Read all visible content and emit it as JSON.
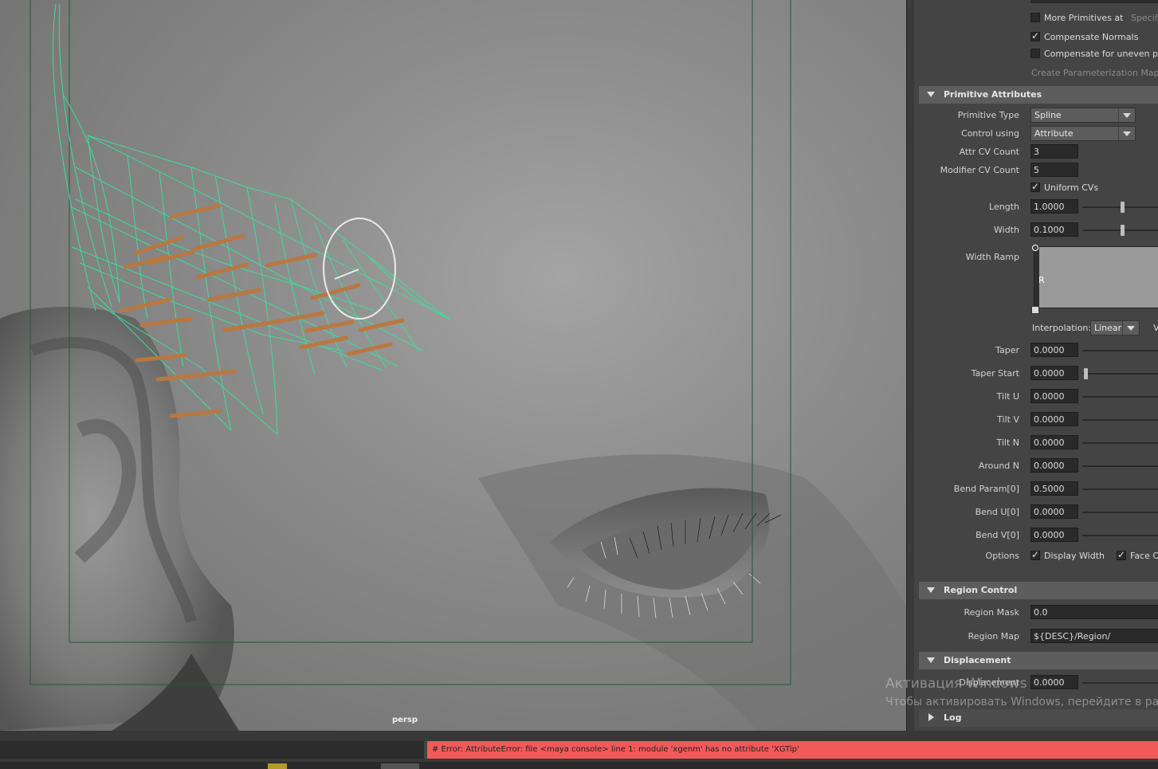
{
  "viewport": {
    "camera": "persp"
  },
  "panel": {
    "more_primitives": {
      "label": "More Primitives at",
      "trail": "Specify",
      "checked": false
    },
    "compensate_normals": {
      "label": "Compensate Normals",
      "checked": true
    },
    "compensate_uneven": {
      "label": "Compensate for uneven par",
      "checked": false
    },
    "create_param_map": "Create Parameterization Map",
    "sections": {
      "primitive_attributes": "Primitive Attributes",
      "region_control": "Region Control",
      "displacement": "Displacement",
      "log": "Log"
    },
    "primitive_type": {
      "label": "Primitive Type",
      "value": "Spline"
    },
    "control_using": {
      "label": "Control using",
      "value": "Attribute"
    },
    "attr_cv_count": {
      "label": "Attr CV Count",
      "value": "3"
    },
    "modifier_cv_count": {
      "label": "Modifier CV Count",
      "value": "5"
    },
    "uniform_cvs": {
      "label": "Uniform CVs",
      "checked": true
    },
    "length": {
      "label": "Length",
      "value": "1.0000",
      "slider": 0.45
    },
    "width": {
      "label": "Width",
      "value": "0.1000",
      "slider": 0.45
    },
    "width_ramp": {
      "label": "Width Ramp",
      "channel": "R"
    },
    "interpolation": {
      "label": "Interpolation:",
      "value": "Linear",
      "trail": "V"
    },
    "taper": {
      "label": "Taper",
      "value": "0.0000"
    },
    "taper_start": {
      "label": "Taper Start",
      "value": "0.0000",
      "slider": 0.02
    },
    "tilt_u": {
      "label": "Tilt U",
      "value": "0.0000"
    },
    "tilt_v": {
      "label": "Tilt V",
      "value": "0.0000"
    },
    "tilt_n": {
      "label": "Tilt N",
      "value": "0.0000"
    },
    "around_n": {
      "label": "Around N",
      "value": "0.0000"
    },
    "bend_param": {
      "label": "Bend Param[0]",
      "value": "0.5000"
    },
    "bend_u": {
      "label": "Bend U[0]",
      "value": "0.0000"
    },
    "bend_v": {
      "label": "Bend V[0]",
      "value": "0.0000"
    },
    "options": {
      "label": "Options",
      "display_width": "Display Width",
      "face_camera": "Face Ca"
    },
    "region_mask": {
      "label": "Region Mask",
      "value": "0.0"
    },
    "region_map": {
      "label": "Region Map",
      "value": "${DESC}/Region/"
    },
    "displacement_field": {
      "label": "Displacement",
      "value": "0.0000"
    }
  },
  "status": {
    "error": "# Error: AttributeError: file <maya console> line 1: module 'xgenm' has no attribute 'XGTip'"
  },
  "watermark": {
    "line1": "Активация Windows",
    "line2": "Чтобы активировать Windows, перейдите в разде"
  }
}
